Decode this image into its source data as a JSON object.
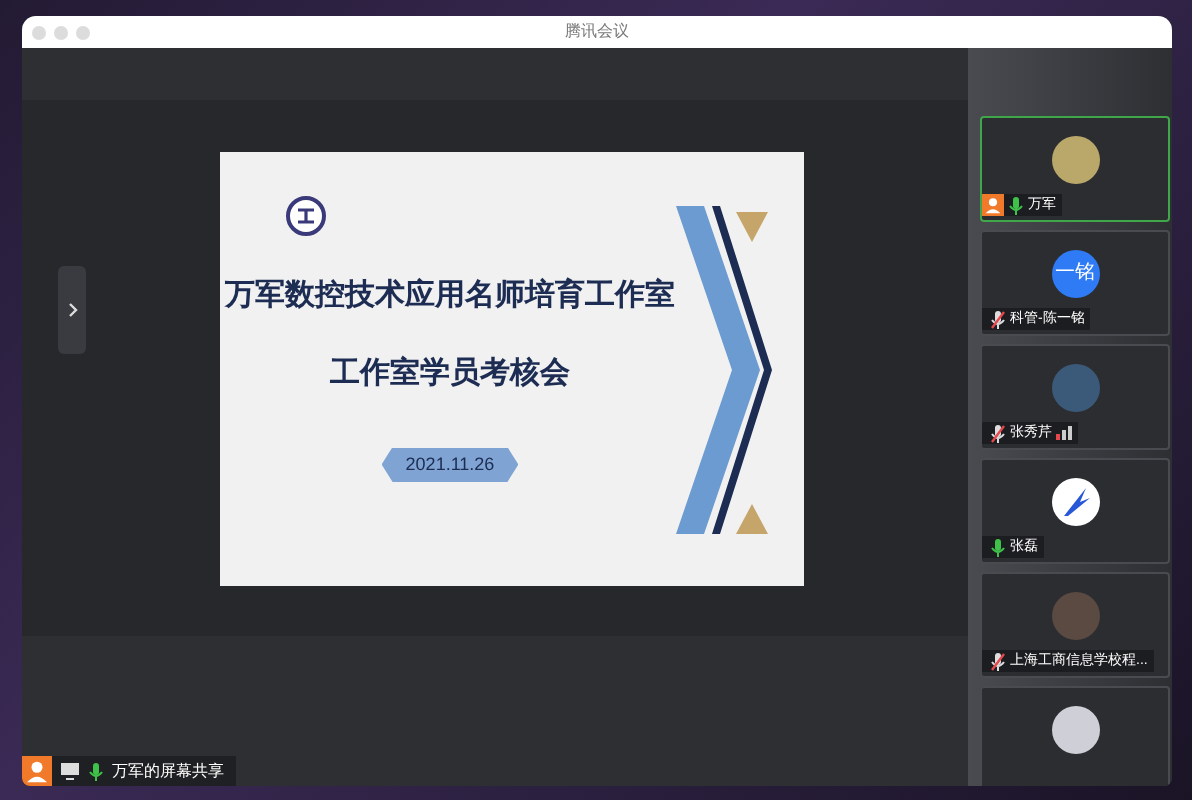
{
  "window": {
    "title": "腾讯会议"
  },
  "slide": {
    "title": "万军数控技术应用名师培育工作室",
    "subtitle": "工作室学员考核会",
    "date": "2021.11.26"
  },
  "participants": [
    {
      "name": "万军",
      "muted": false,
      "selected": true,
      "host": true,
      "signal": false,
      "kind": "photo"
    },
    {
      "name": "科管-陈一铭",
      "muted": true,
      "selected": false,
      "host": false,
      "signal": false,
      "kind": "initials",
      "avatar_text": "一铭"
    },
    {
      "name": "张秀芹",
      "muted": true,
      "selected": false,
      "host": false,
      "signal": true,
      "kind": "photo"
    },
    {
      "name": "张磊",
      "muted": false,
      "selected": false,
      "host": false,
      "signal": false,
      "kind": "logo"
    },
    {
      "name": "上海工商信息学校程...",
      "muted": true,
      "selected": false,
      "host": false,
      "signal": false,
      "kind": "photo"
    }
  ],
  "share_bar": {
    "label": "万军的屏幕共享",
    "host": true,
    "muted": false
  }
}
